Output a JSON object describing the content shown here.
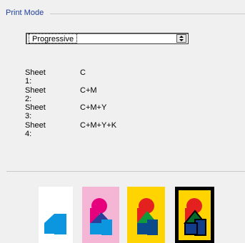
{
  "group": {
    "title": "Print Mode"
  },
  "select": {
    "value": "Progressive"
  },
  "sheets": [
    {
      "label": "Sheet 1:",
      "value": "C"
    },
    {
      "label": "Sheet 2:",
      "value": "C+M"
    },
    {
      "label": "Sheet 3:",
      "value": "C+M+Y"
    },
    {
      "label": "Sheet 4:",
      "value": "C+M+Y+K"
    }
  ],
  "colors": {
    "cyan": "#0b96df",
    "magenta": "#e7007e",
    "yellow": "#ffd400",
    "pink_bg": "#f5b6d6",
    "green": "#0f9a3c",
    "navy": "#0b4b8c",
    "red": "#e5211f",
    "dark_blue": "#113d8a"
  },
  "thumbnails": [
    {
      "name": "cyan-only",
      "selected": false
    },
    {
      "name": "cyan-magenta",
      "selected": false
    },
    {
      "name": "cyan-magenta-yellow",
      "selected": false
    },
    {
      "name": "cyan-magenta-yellow-black",
      "selected": true
    }
  ]
}
